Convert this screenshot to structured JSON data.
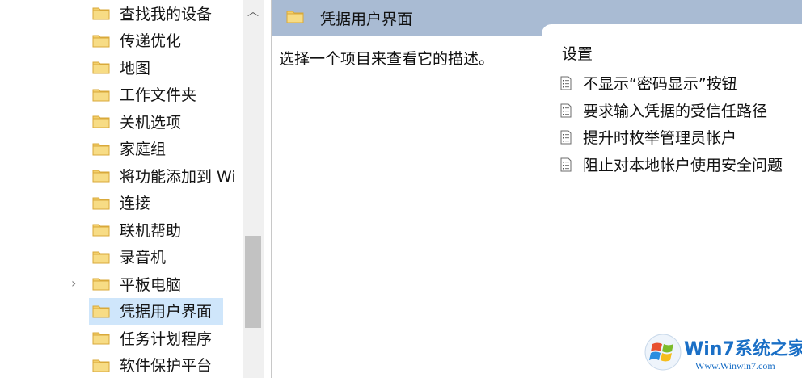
{
  "tree": {
    "items": [
      {
        "label": "查找我的设备"
      },
      {
        "label": "传递优化"
      },
      {
        "label": "地图"
      },
      {
        "label": "工作文件夹"
      },
      {
        "label": "关机选项"
      },
      {
        "label": "家庭组"
      },
      {
        "label": "将功能添加到 Wi"
      },
      {
        "label": "连接"
      },
      {
        "label": "联机帮助"
      },
      {
        "label": "录音机"
      },
      {
        "label": "平板电脑",
        "expander": "›"
      },
      {
        "label": "凭据用户界面",
        "selected": true
      },
      {
        "label": "任务计划程序"
      },
      {
        "label": "软件保护平台"
      }
    ],
    "scroll_up_glyph": "︿"
  },
  "detail": {
    "title": "凭据用户界面",
    "description": "选择一个项目来查看它的描述。",
    "settings_heading": "设置",
    "settings": [
      {
        "label": "不显示“密码显示”按钮"
      },
      {
        "label": "要求输入凭据的受信任路径"
      },
      {
        "label": "提升时枚举管理员帐户"
      },
      {
        "label": "阻止对本地帐户使用安全问题"
      }
    ]
  },
  "watermark": {
    "brand": "Win7系统之家",
    "url": "Www.Winwin7.com"
  },
  "colors": {
    "header": "#a9bbd3",
    "selection": "#cfe6fb",
    "folder": "#f3cf6b",
    "brand": "#1a6fc6"
  },
  "icons": {
    "folder": "folder-icon",
    "setting": "policy-document-icon",
    "expander": "chevron-right-icon"
  }
}
